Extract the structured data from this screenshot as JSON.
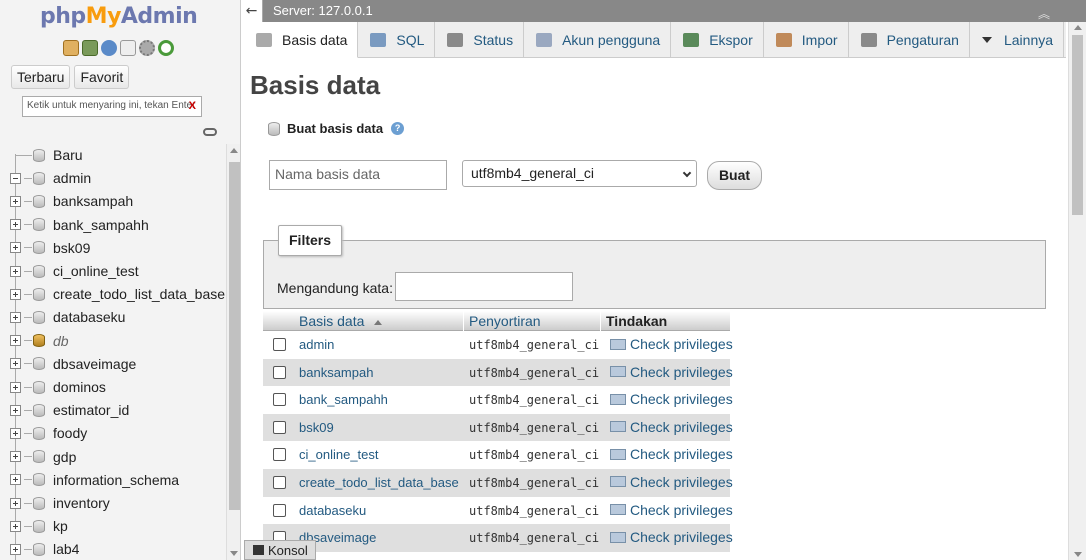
{
  "nav": {
    "logo": {
      "part1": "php",
      "part2": "My",
      "part3": "Admin"
    },
    "icons": [
      "home-icon",
      "logout-icon",
      "help-icon",
      "docs-icon",
      "settings-icon",
      "reload-icon"
    ],
    "tabs": [
      "Terbaru",
      "Favorit"
    ],
    "filter_placeholder": "Ketik untuk menyaring ini, tekan Enter",
    "filter_clear": "X",
    "tree": [
      {
        "label": "Baru",
        "kind": "new"
      },
      {
        "label": "admin",
        "kind": "open"
      },
      {
        "label": "banksampah",
        "kind": "closed"
      },
      {
        "label": "bank_sampahh",
        "kind": "closed"
      },
      {
        "label": "bsk09",
        "kind": "closed"
      },
      {
        "label": "ci_online_test",
        "kind": "closed"
      },
      {
        "label": "create_todo_list_data_base",
        "kind": "closed"
      },
      {
        "label": "databaseku",
        "kind": "closed"
      },
      {
        "label": "db",
        "kind": "closed-special"
      },
      {
        "label": "dbsaveimage",
        "kind": "closed"
      },
      {
        "label": "dominos",
        "kind": "closed"
      },
      {
        "label": "estimator_id",
        "kind": "closed"
      },
      {
        "label": "foody",
        "kind": "closed"
      },
      {
        "label": "gdp",
        "kind": "closed"
      },
      {
        "label": "information_schema",
        "kind": "closed"
      },
      {
        "label": "inventory",
        "kind": "closed"
      },
      {
        "label": "kp",
        "kind": "closed"
      },
      {
        "label": "lab4",
        "kind": "closed"
      }
    ]
  },
  "topbar": {
    "server": "Server: 127.0.0.1"
  },
  "tabs": [
    {
      "label": "Basis data",
      "icon": "database-icon",
      "active": true
    },
    {
      "label": "SQL",
      "icon": "sql-icon"
    },
    {
      "label": "Status",
      "icon": "status-icon"
    },
    {
      "label": "Akun pengguna",
      "icon": "users-icon"
    },
    {
      "label": "Ekspor",
      "icon": "export-icon"
    },
    {
      "label": "Impor",
      "icon": "import-icon"
    },
    {
      "label": "Pengaturan",
      "icon": "settings-icon"
    },
    {
      "label": "Lainnya",
      "icon": "caret-down-icon"
    }
  ],
  "main": {
    "title": "Basis data",
    "create_heading": "Buat basis data",
    "dbname_placeholder": "Nama basis data",
    "collation_value": "utf8mb4_general_ci",
    "create_button": "Buat",
    "filters_legend": "Filters",
    "filter_label": "Mengandung kata:",
    "table": {
      "headers": [
        "Basis data",
        "Penyortiran",
        "Tindakan"
      ],
      "action_label": "Check privileges",
      "rows": [
        {
          "name": "admin",
          "collation": "utf8mb4_general_ci"
        },
        {
          "name": "banksampah",
          "collation": "utf8mb4_general_ci"
        },
        {
          "name": "bank_sampahh",
          "collation": "utf8mb4_general_ci"
        },
        {
          "name": "bsk09",
          "collation": "utf8mb4_general_ci"
        },
        {
          "name": "ci_online_test",
          "collation": "utf8mb4_general_ci"
        },
        {
          "name": "create_todo_list_data_base",
          "collation": "utf8mb4_general_ci"
        },
        {
          "name": "databaseku",
          "collation": "utf8mb4_general_ci"
        },
        {
          "name": "dbsaveimage",
          "collation": "utf8mb4_general_ci"
        }
      ]
    }
  },
  "console": {
    "label": "Konsol"
  }
}
